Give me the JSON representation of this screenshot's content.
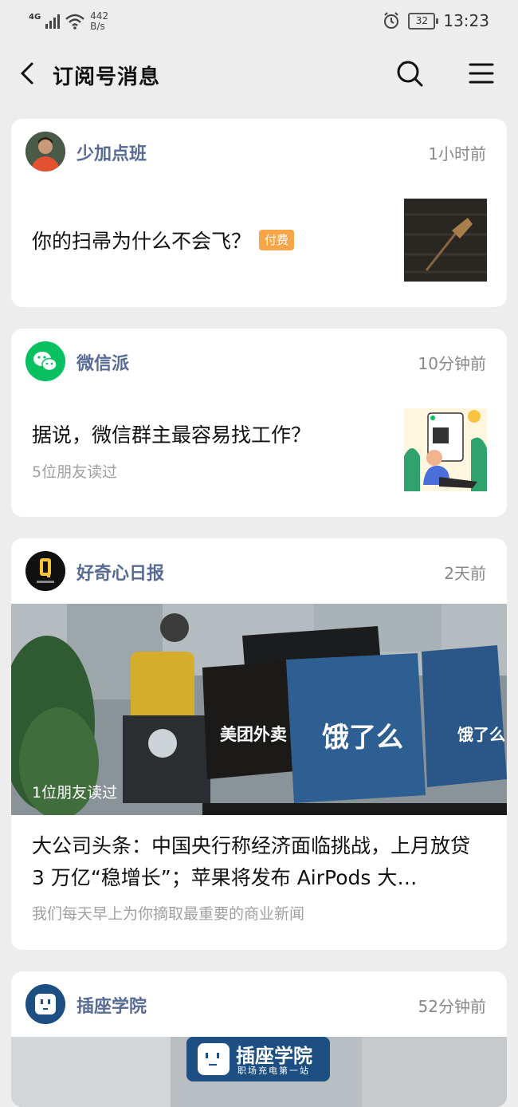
{
  "status_bar": {
    "network": "4G",
    "speed_value": "442",
    "speed_unit": "B/s",
    "battery": "32",
    "time": "13:23"
  },
  "nav": {
    "title": "订阅号消息",
    "icons": [
      "back-icon",
      "search-icon",
      "menu-icon"
    ]
  },
  "cards": [
    {
      "account": "少加点班",
      "time": "1小时前",
      "title": "你的扫帚为什么不会飞？",
      "badge": "付费"
    },
    {
      "account": "微信派",
      "time": "10分钟前",
      "title": "据说，微信群主最容易找工作？",
      "subtitle": "5位朋友读过"
    },
    {
      "account": "好奇心日报",
      "time": "2天前",
      "image_caption": "1位朋友读过",
      "title": "大公司头条：中国央行称经济面临挑战，上月放贷 3 万亿“稳增长”；苹果将发布 AirPods 大…",
      "subtitle": "我们每天早上为你摘取最重要的商业新闻",
      "image_text": {
        "box_left": "美团外卖",
        "box_right": "饿了么"
      }
    },
    {
      "account": "插座学院",
      "time": "52分钟前",
      "banner_title": "插座学院",
      "banner_sub": "职场充电第一站"
    }
  ],
  "colors": {
    "background": "#ededed",
    "account_name": "#576b95",
    "paid_badge": "#f6a646",
    "wechat_green": "#07c160"
  }
}
